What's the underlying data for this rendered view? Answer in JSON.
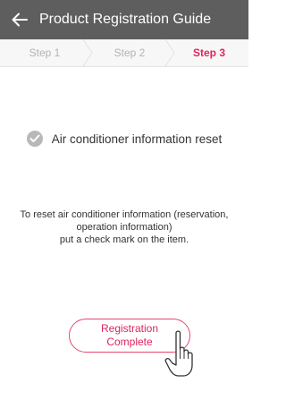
{
  "header": {
    "title": "Product Registration Guide",
    "back_icon": "back-arrow-icon"
  },
  "steps": {
    "items": [
      {
        "label": "Step 1",
        "active": false
      },
      {
        "label": "Step 2",
        "active": false
      },
      {
        "label": "Step 3",
        "active": true
      }
    ],
    "active_color": "#e0245e",
    "inactive_color": "#b3b3b3"
  },
  "checkbox": {
    "label": "Air conditioner information reset",
    "checked": true
  },
  "instruction": {
    "line1": "To reset air conditioner information (reservation,",
    "line2": "operation information)",
    "line3": "put a check mark on the item."
  },
  "registration_button": {
    "line1": "Registration",
    "line2": "Complete",
    "border_color": "#e8476f"
  },
  "colors": {
    "header_bg": "#5e5e5e",
    "accent": "#e0245e"
  },
  "pointer_icon": "hand-pointer-icon"
}
